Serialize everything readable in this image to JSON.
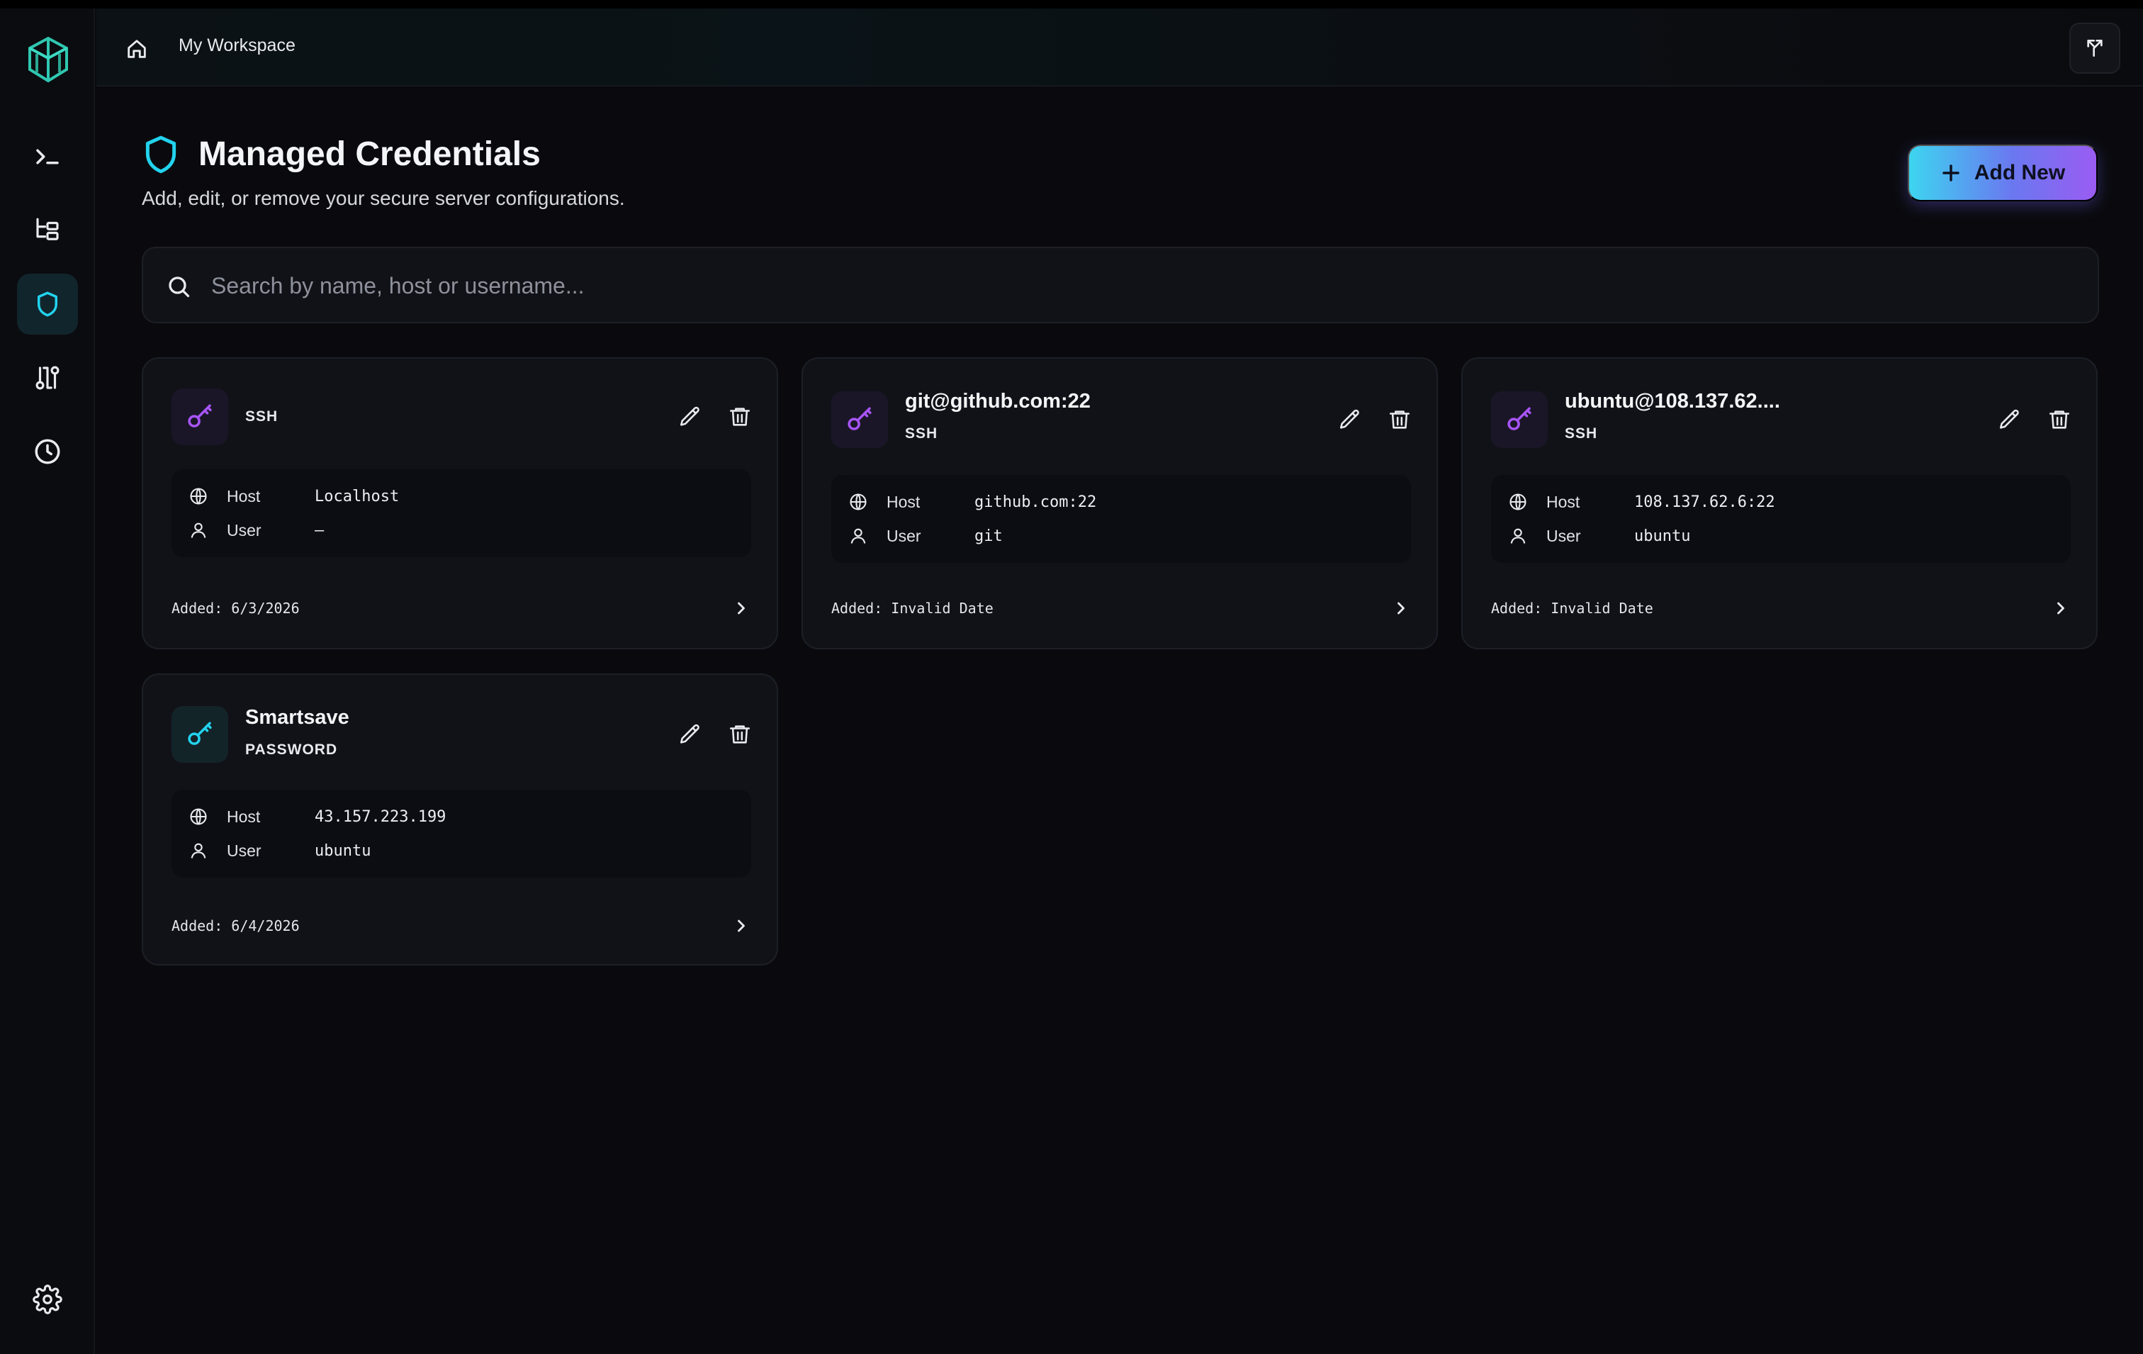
{
  "header": {
    "workspace": "My Workspace"
  },
  "page": {
    "title": "Managed Credentials",
    "subtitle": "Add, edit, or remove your secure server configurations.",
    "add_label": "Add New"
  },
  "search": {
    "placeholder": "Search by name, host or username..."
  },
  "labels": {
    "host": "Host",
    "user": "User"
  },
  "colors": {
    "accent_cyan": "#22d3ee",
    "accent_purple": "#a855f7",
    "background": "#0a0a0e",
    "card": "#111218"
  },
  "icons": {
    "sidebar": [
      "terminal-icon",
      "file-tree-icon",
      "shield-icon",
      "tunnel-icon",
      "history-icon",
      "settings-icon"
    ],
    "header": [
      "home-icon",
      "share-icon"
    ]
  },
  "cards": [
    {
      "name": "",
      "type": "SSH",
      "host": "Localhost",
      "user": "–",
      "added": "Added: 6/3/2026"
    },
    {
      "name": "git@github.com:22",
      "type": "SSH",
      "host": "github.com:22",
      "user": "git",
      "added": "Added: Invalid Date"
    },
    {
      "name": "ubuntu@108.137.62....",
      "type": "SSH",
      "host": "108.137.62.6:22",
      "user": "ubuntu",
      "added": "Added: Invalid Date"
    },
    {
      "name": "Smartsave",
      "type": "PASSWORD",
      "host": "43.157.223.199",
      "user": "ubuntu",
      "added": "Added: 6/4/2026"
    }
  ]
}
